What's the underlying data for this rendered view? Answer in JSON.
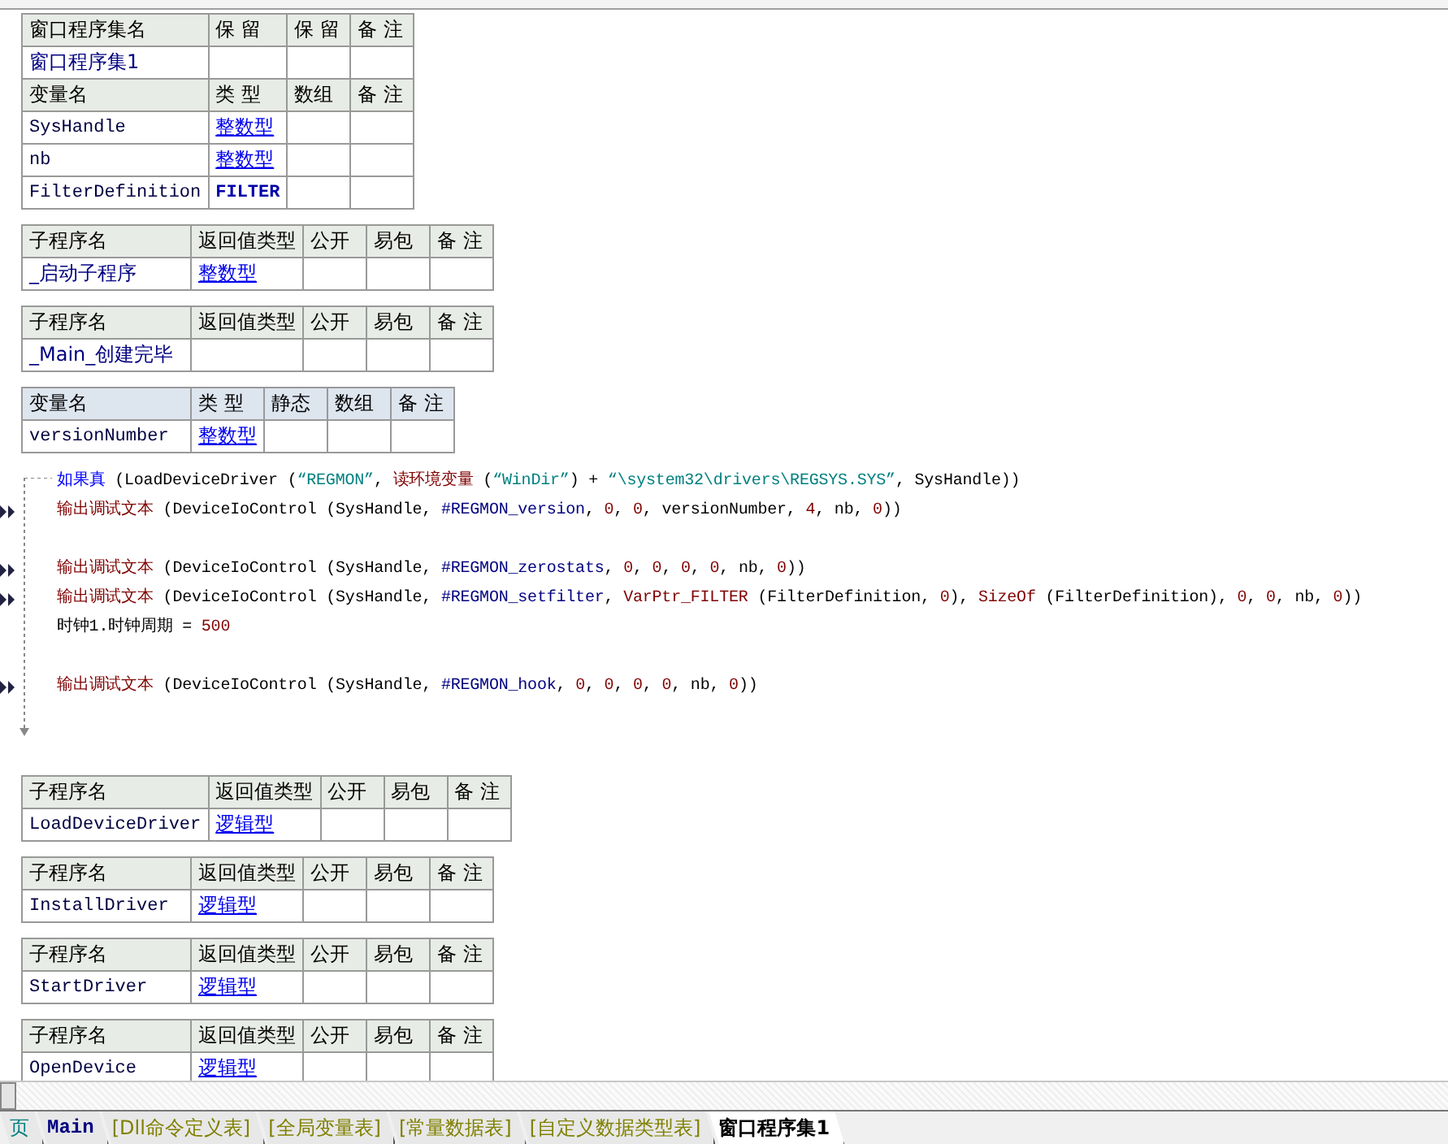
{
  "top_tables": [
    {
      "rows": [
        {
          "kind": "header",
          "cells": [
            {
              "text": "窗口程序集名"
            },
            {
              "text": "保 留"
            },
            {
              "text": "保 留"
            },
            {
              "text": "备 注"
            }
          ]
        },
        {
          "kind": "data",
          "cells": [
            {
              "text": "窗口程序集1",
              "kind": "name"
            }
          ]
        },
        {
          "kind": "header",
          "cells": [
            {
              "text": "变量名"
            },
            {
              "text": "类 型"
            },
            {
              "text": "数组"
            },
            {
              "text": "备 注"
            }
          ]
        },
        {
          "kind": "data",
          "cells": [
            {
              "text": "SysHandle",
              "kind": "code"
            },
            {
              "text": "整数型",
              "kind": "type"
            }
          ]
        },
        {
          "kind": "data",
          "cells": [
            {
              "text": "nb",
              "kind": "code"
            },
            {
              "text": "整数型",
              "kind": "type"
            }
          ]
        },
        {
          "kind": "data",
          "cells": [
            {
              "text": "FilterDefinition",
              "kind": "code"
            },
            {
              "text": "FILTER",
              "kind": "custom_type"
            }
          ]
        }
      ]
    },
    {
      "rows": [
        {
          "kind": "header",
          "cells": [
            {
              "text": "子程序名"
            },
            {
              "text": "返回值类型"
            },
            {
              "text": "公开"
            },
            {
              "text": "易包"
            },
            {
              "text": "备 注"
            }
          ]
        },
        {
          "kind": "data",
          "cells": [
            {
              "text": "_启动子程序",
              "kind": "name"
            },
            {
              "text": "整数型",
              "kind": "type"
            }
          ]
        }
      ]
    },
    {
      "rows": [
        {
          "kind": "header",
          "cells": [
            {
              "text": "子程序名"
            },
            {
              "text": "返回值类型"
            },
            {
              "text": "公开"
            },
            {
              "text": "易包"
            },
            {
              "text": "备 注"
            }
          ]
        },
        {
          "kind": "data",
          "cells": [
            {
              "text": "_Main_创建完毕",
              "kind": "name"
            }
          ]
        }
      ]
    },
    {
      "rows": [
        {
          "kind": "var_header",
          "cells": [
            {
              "text": "变量名"
            },
            {
              "text": "类 型"
            },
            {
              "text": "静态"
            },
            {
              "text": "数组"
            },
            {
              "text": "备 注"
            }
          ]
        },
        {
          "kind": "data",
          "cells": [
            {
              "text": "versionNumber",
              "kind": "code"
            },
            {
              "text": "整数型",
              "kind": "type"
            }
          ]
        }
      ]
    }
  ],
  "code": {
    "lines": [
      {
        "kind": "statement",
        "marked": false,
        "segments": [
          {
            "kind": "kw",
            "text": "如果真"
          },
          {
            "kind": "plain",
            "text": " (LoadDeviceDriver ("
          },
          {
            "kind": "str",
            "text": "“REGMON”"
          },
          {
            "kind": "plain",
            "text": ", "
          },
          {
            "kind": "cmd",
            "text": "读环境变量"
          },
          {
            "kind": "plain",
            "text": " ("
          },
          {
            "kind": "str",
            "text": "“WinDir”"
          },
          {
            "kind": "plain",
            "text": ") + "
          },
          {
            "kind": "str",
            "text": "“\\system32\\drivers\\REGSYS.SYS”"
          },
          {
            "kind": "plain",
            "text": ", SysHandle))"
          }
        ]
      },
      {
        "kind": "statement",
        "marked": true,
        "segments": [
          {
            "kind": "cmd",
            "text": "输出调试文本"
          },
          {
            "kind": "plain",
            "text": " (DeviceIoControl (SysHandle, "
          },
          {
            "kind": "const",
            "text": "#REGMON_version"
          },
          {
            "kind": "plain",
            "text": ", "
          },
          {
            "kind": "num",
            "text": "0"
          },
          {
            "kind": "plain",
            "text": ", "
          },
          {
            "kind": "num",
            "text": "0"
          },
          {
            "kind": "plain",
            "text": ", versionNumber, "
          },
          {
            "kind": "num",
            "text": "4"
          },
          {
            "kind": "plain",
            "text": ", nb, "
          },
          {
            "kind": "num",
            "text": "0"
          },
          {
            "kind": "plain",
            "text": "))"
          }
        ]
      },
      {
        "kind": "blank"
      },
      {
        "kind": "statement",
        "marked": true,
        "segments": [
          {
            "kind": "cmd",
            "text": "输出调试文本"
          },
          {
            "kind": "plain",
            "text": " (DeviceIoControl (SysHandle, "
          },
          {
            "kind": "const",
            "text": "#REGMON_zerostats"
          },
          {
            "kind": "plain",
            "text": ", "
          },
          {
            "kind": "num",
            "text": "0"
          },
          {
            "kind": "plain",
            "text": ", "
          },
          {
            "kind": "num",
            "text": "0"
          },
          {
            "kind": "plain",
            "text": ", "
          },
          {
            "kind": "num",
            "text": "0"
          },
          {
            "kind": "plain",
            "text": ", "
          },
          {
            "kind": "num",
            "text": "0"
          },
          {
            "kind": "plain",
            "text": ", nb, "
          },
          {
            "kind": "num",
            "text": "0"
          },
          {
            "kind": "plain",
            "text": "))"
          }
        ]
      },
      {
        "kind": "statement",
        "marked": true,
        "segments": [
          {
            "kind": "cmd",
            "text": "输出调试文本"
          },
          {
            "kind": "plain",
            "text": " (DeviceIoControl (SysHandle, "
          },
          {
            "kind": "const",
            "text": "#REGMON_setfilter"
          },
          {
            "kind": "plain",
            "text": ", "
          },
          {
            "kind": "cmd",
            "text": "VarPtr_FILTER"
          },
          {
            "kind": "plain",
            "text": " (FilterDefinition, "
          },
          {
            "kind": "num",
            "text": "0"
          },
          {
            "kind": "plain",
            "text": "), "
          },
          {
            "kind": "cmd",
            "text": "SizeOf"
          },
          {
            "kind": "plain",
            "text": " (FilterDefinition), "
          },
          {
            "kind": "num",
            "text": "0"
          },
          {
            "kind": "plain",
            "text": ", "
          },
          {
            "kind": "num",
            "text": "0"
          },
          {
            "kind": "plain",
            "text": ", nb, "
          },
          {
            "kind": "num",
            "text": "0"
          },
          {
            "kind": "plain",
            "text": "))"
          }
        ]
      },
      {
        "kind": "statement",
        "marked": false,
        "segments": [
          {
            "kind": "plain",
            "text": "时钟1.时钟周期 = "
          },
          {
            "kind": "num",
            "text": "500"
          }
        ]
      },
      {
        "kind": "blank"
      },
      {
        "kind": "statement",
        "marked": true,
        "segments": [
          {
            "kind": "cmd",
            "text": "输出调试文本"
          },
          {
            "kind": "plain",
            "text": " (DeviceIoControl (SysHandle, "
          },
          {
            "kind": "const",
            "text": "#REGMON_hook"
          },
          {
            "kind": "plain",
            "text": ", "
          },
          {
            "kind": "num",
            "text": "0"
          },
          {
            "kind": "plain",
            "text": ", "
          },
          {
            "kind": "num",
            "text": "0"
          },
          {
            "kind": "plain",
            "text": ", "
          },
          {
            "kind": "num",
            "text": "0"
          },
          {
            "kind": "plain",
            "text": ", "
          },
          {
            "kind": "num",
            "text": "0"
          },
          {
            "kind": "plain",
            "text": ", nb, "
          },
          {
            "kind": "num",
            "text": "0"
          },
          {
            "kind": "plain",
            "text": "))"
          }
        ]
      }
    ]
  },
  "bottom_tables": [
    {
      "rows": [
        {
          "kind": "header",
          "cells": [
            {
              "text": "子程序名"
            },
            {
              "text": "返回值类型"
            },
            {
              "text": "公开"
            },
            {
              "text": "易包"
            },
            {
              "text": "备 注"
            }
          ]
        },
        {
          "kind": "data",
          "cells": [
            {
              "text": "LoadDeviceDriver",
              "kind": "code"
            },
            {
              "text": "逻辑型",
              "kind": "type"
            }
          ]
        }
      ]
    },
    {
      "rows": [
        {
          "kind": "header",
          "cells": [
            {
              "text": "子程序名"
            },
            {
              "text": "返回值类型"
            },
            {
              "text": "公开"
            },
            {
              "text": "易包"
            },
            {
              "text": "备 注"
            }
          ]
        },
        {
          "kind": "data",
          "cells": [
            {
              "text": "InstallDriver",
              "kind": "code"
            },
            {
              "text": "逻辑型",
              "kind": "type"
            }
          ]
        }
      ]
    },
    {
      "rows": [
        {
          "kind": "header",
          "cells": [
            {
              "text": "子程序名"
            },
            {
              "text": "返回值类型"
            },
            {
              "text": "公开"
            },
            {
              "text": "易包"
            },
            {
              "text": "备 注"
            }
          ]
        },
        {
          "kind": "data",
          "cells": [
            {
              "text": "StartDriver",
              "kind": "code"
            },
            {
              "text": "逻辑型",
              "kind": "type"
            }
          ]
        }
      ]
    },
    {
      "rows": [
        {
          "kind": "header",
          "cells": [
            {
              "text": "子程序名"
            },
            {
              "text": "返回值类型"
            },
            {
              "text": "公开"
            },
            {
              "text": "易包"
            },
            {
              "text": "备 注"
            }
          ]
        },
        {
          "kind": "data",
          "cells": [
            {
              "text": "OpenDevice",
              "kind": "code"
            },
            {
              "text": "逻辑型",
              "kind": "type"
            }
          ]
        }
      ]
    }
  ],
  "tabs": [
    {
      "label": "页",
      "kind": "home",
      "selected": false
    },
    {
      "label": "Main",
      "kind": "code",
      "selected": false
    },
    {
      "label": "[Dll命令定义表]",
      "kind": "table",
      "selected": false
    },
    {
      "label": "[全局变量表]",
      "kind": "table",
      "selected": false
    },
    {
      "label": "[常量数据表]",
      "kind": "table",
      "selected": false
    },
    {
      "label": "[自定义数据类型表]",
      "kind": "table",
      "selected": false
    },
    {
      "label": "窗口程序集1",
      "kind": "code",
      "selected": true
    }
  ]
}
